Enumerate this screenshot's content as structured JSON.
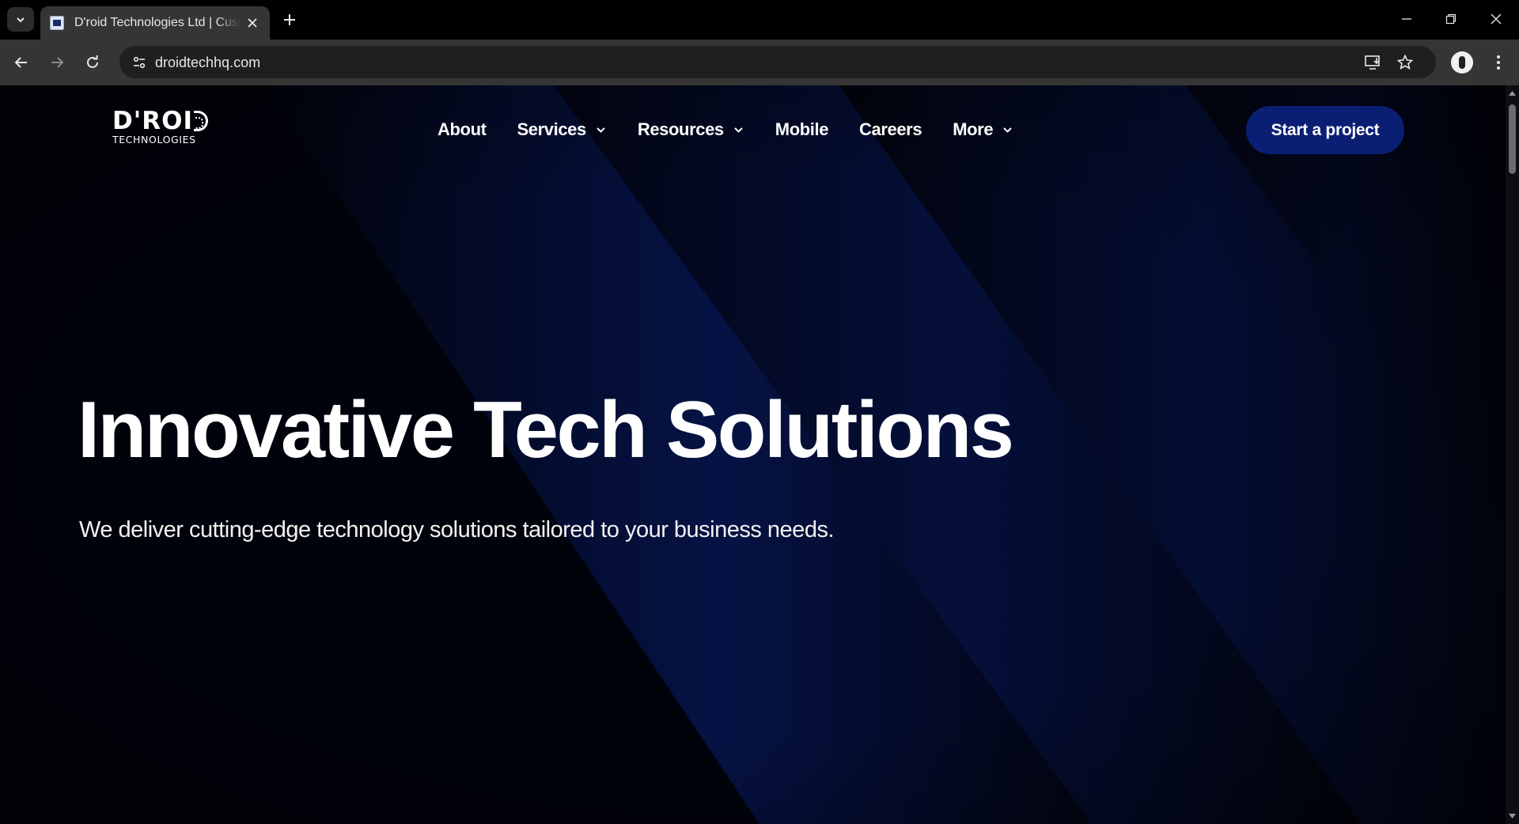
{
  "browser": {
    "tab": {
      "title": "D'roid Technologies Ltd | Custom Software Development"
    },
    "address_bar": {
      "url": "droidtechhq.com"
    }
  },
  "site": {
    "logo": {
      "main": "D'ROI",
      "sub": "TECHNOLOGIES"
    },
    "nav": [
      {
        "label": "About",
        "dropdown": false
      },
      {
        "label": "Services",
        "dropdown": true
      },
      {
        "label": "Resources",
        "dropdown": true
      },
      {
        "label": "Mobile",
        "dropdown": false
      },
      {
        "label": "Careers",
        "dropdown": false
      },
      {
        "label": "More",
        "dropdown": true
      }
    ],
    "cta_label": "Start a project",
    "hero": {
      "title": "Innovative Tech Solutions",
      "subtitle": "We deliver cutting-edge technology solutions tailored to your business needs."
    }
  },
  "colors": {
    "page_background": "#01030c",
    "beam_blue": "#0a1f73",
    "cta_background": "#0a1f73",
    "chrome_toolbar": "#353535"
  }
}
